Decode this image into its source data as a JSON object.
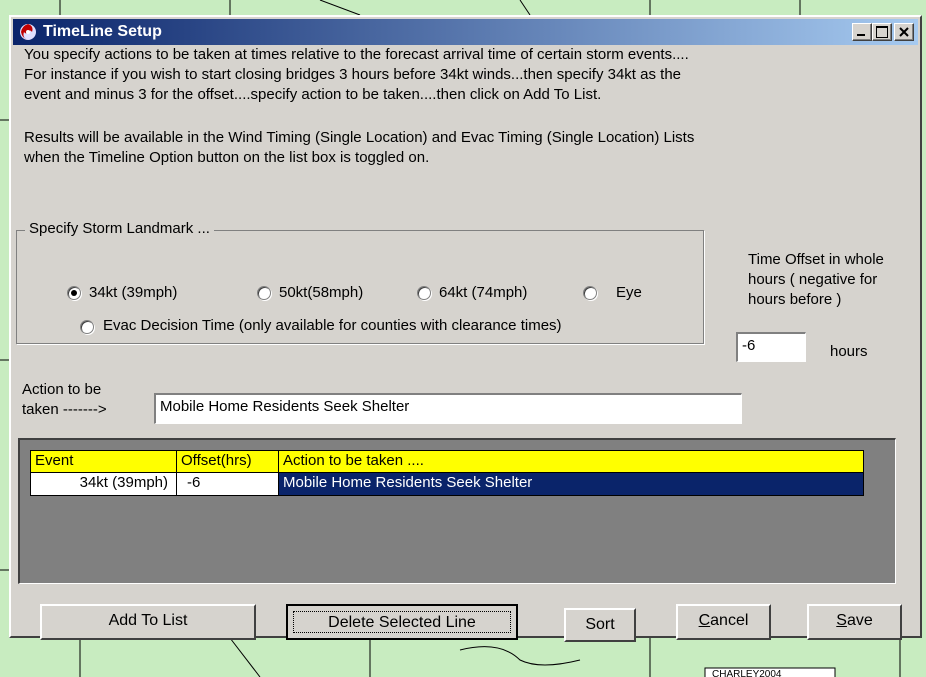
{
  "window": {
    "title": "TimeLine Setup"
  },
  "intro": {
    "line1": "You specify actions to be taken at times relative to the forecast arrival time of certain storm events....",
    "line2": "For instance if you wish to start closing bridges 3 hours before 34kt winds...then specify  34kt as the",
    "line3": "event and  minus 3 for the offset....specify action to be taken....then click on Add To List.",
    "line4": "Results will be available in the Wind Timing (Single Location)  and Evac Timing (Single Location)  Lists",
    "line5": "when the Timeline Option button on the list box is toggled on."
  },
  "landmark": {
    "group_label": "Specify Storm Landmark ...",
    "options": [
      {
        "label": "34kt (39mph)",
        "selected": true
      },
      {
        "label": "50kt(58mph)",
        "selected": false
      },
      {
        "label": "64kt (74mph)",
        "selected": false
      },
      {
        "label": "Eye",
        "selected": false
      },
      {
        "label": "Evac Decision Time (only available for counties with clearance times)",
        "selected": false
      }
    ]
  },
  "offset": {
    "label_line1": "Time Offset in whole",
    "label_line2": "hours ( negative for",
    "label_line3": "hours before )",
    "value": "-6",
    "unit": "hours"
  },
  "action": {
    "label_line1": "Action to be",
    "label_line2": "taken ------->",
    "value": "Mobile Home Residents Seek Shelter"
  },
  "grid": {
    "headers": [
      "Event",
      "Offset(hrs)",
      "Action to be taken ...."
    ],
    "rows": [
      {
        "event": "34kt (39mph)",
        "offset": "-6",
        "action": "Mobile Home Residents Seek Shelter"
      }
    ]
  },
  "buttons": {
    "add": "Add To List",
    "delete": "Delete Selected Line",
    "sort": "Sort",
    "cancel_u": "C",
    "cancel_rest": "ancel",
    "save_u": "S",
    "save_rest": "ave"
  },
  "map": {
    "label": "CHARLEY2004"
  },
  "colors": {
    "grid_header": "#ffff00",
    "selection": "#0a246a",
    "map_land": "#c8ecc0"
  }
}
